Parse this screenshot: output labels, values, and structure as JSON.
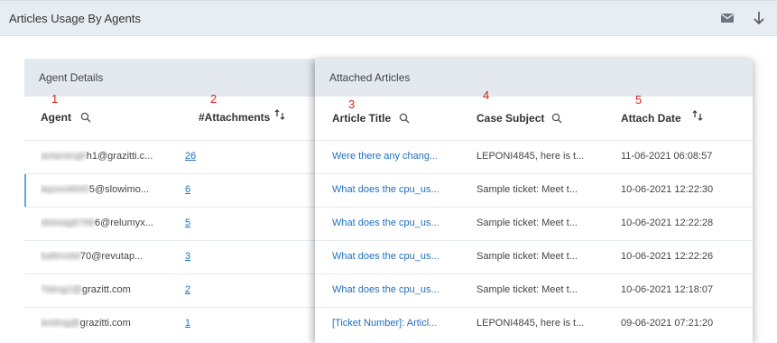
{
  "header": {
    "title": "Articles Usage By Agents"
  },
  "agent_panel": {
    "title": "Agent Details",
    "columns": {
      "agent": "Agent",
      "attachments": "#Attachments"
    },
    "markers": [
      "1",
      "2"
    ],
    "rows": [
      {
        "agent_prefix": "avtarsingh",
        "agent_visible": "h1@grazitti.c...",
        "attachments": "26",
        "selected": false
      },
      {
        "agent_prefix": "leponi4845",
        "agent_visible": "5@slowimo...",
        "attachments": "6",
        "selected": true
      },
      {
        "agent_prefix": "deloiag8766",
        "agent_visible": "6@relumyx...",
        "attachments": "5",
        "selected": false
      },
      {
        "agent_prefix": "bafimobil",
        "agent_visible": "70@revutap...",
        "attachments": "3",
        "selected": false
      },
      {
        "agent_prefix": "Tsting2@",
        "agent_visible": "grazitt.com",
        "attachments": "2",
        "selected": false
      },
      {
        "agent_prefix": "testing@",
        "agent_visible": "grazitti.com",
        "attachments": "1",
        "selected": false
      }
    ]
  },
  "articles_panel": {
    "title": "Attached Articles",
    "columns": {
      "article_title": "Article Title",
      "case_subject": "Case Subject",
      "attach_date": "Attach Date"
    },
    "markers": [
      "3",
      "4",
      "5"
    ],
    "rows": [
      {
        "title": "Were there any chang...",
        "subject": "LEPONI4845, here is t...",
        "date": "11-06-2021 06:08:57"
      },
      {
        "title": "What does the cpu_us...",
        "subject": "Sample ticket: Meet t...",
        "date": "10-06-2021 12:22:30"
      },
      {
        "title": "What does the cpu_us...",
        "subject": "Sample ticket: Meet t...",
        "date": "10-06-2021 12:22:28"
      },
      {
        "title": "What does the cpu_us...",
        "subject": "Sample ticket: Meet t...",
        "date": "10-06-2021 12:22:26"
      },
      {
        "title": "What does the cpu_us...",
        "subject": "Sample ticket: Meet t...",
        "date": "10-06-2021 12:18:07"
      },
      {
        "title": "[Ticket Number]: Articl...",
        "subject": "LEPONI4845, here is t...",
        "date": "09-06-2021 07:21:20"
      }
    ]
  },
  "icons": {
    "mail": "mail-icon",
    "download": "download-arrow-icon",
    "search": "search-icon",
    "sort": "sort-icon"
  },
  "colors": {
    "accent": "#1e6fc0",
    "marker": "#e0201b",
    "header_bg": "#e8edf2",
    "selection": "#5aa8e6"
  }
}
